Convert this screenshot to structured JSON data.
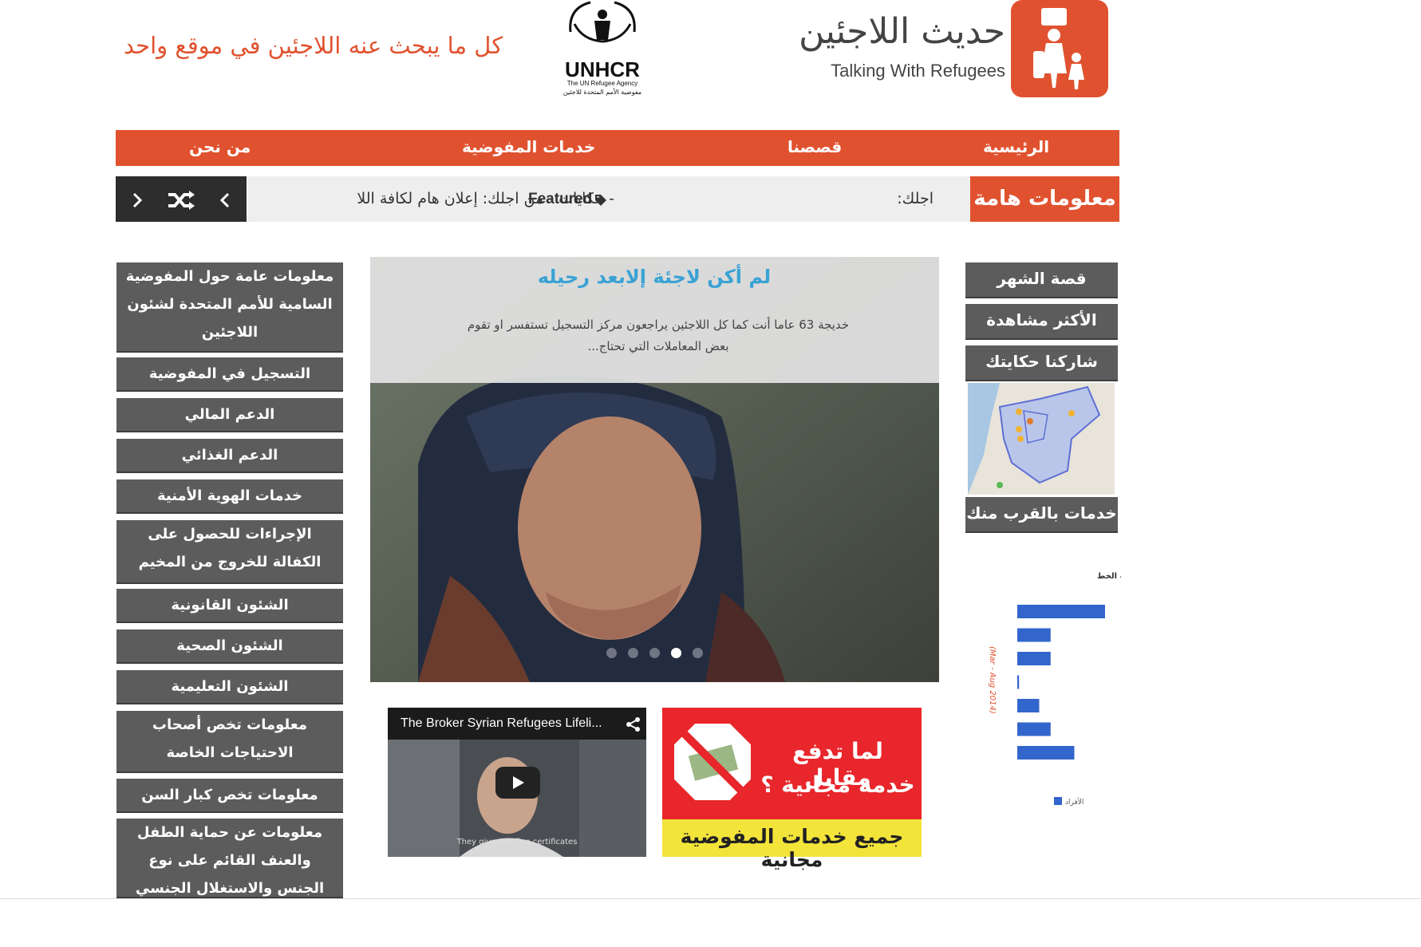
{
  "header": {
    "logo_ar": "حديث اللاجئين",
    "logo_en": "Talking With Refugees",
    "unhcr_name": "UNHCR",
    "unhcr_sub_en": "The UN Refugee Agency",
    "unhcr_sub_ar": "مفوضية الأمم المتحدة للاجئين",
    "tagline": "كل ما يبحث عنه اللاجئين في موقع واحد",
    "brand_color": "#e0522f"
  },
  "nav": {
    "items": [
      "الرئيسية",
      "قصصنا",
      "خدمات المفوضية",
      "من نحن"
    ]
  },
  "ticker": {
    "label": "معلومات هامة",
    "prefix": "اجلك:",
    "category": "Featured",
    "text": "- حكايات - من اجلك: إعلان هام لكافة اللا",
    "tag_icon": "tag-icon",
    "controls": [
      "chevron-right-icon",
      "shuffle-icon",
      "chevron-left-icon"
    ]
  },
  "left_menu": [
    "معلومات عامة حول المفوضية السامية للأمم المتحدة لشئون اللاجئين",
    "التسجيل في المفوضية",
    "الدعم المالي",
    "الدعم الغذائي",
    "خدمات الهوية الأمنية",
    "الإجراءات للحصول على الكفالة للخروج من المخيم",
    "الشئون القانونية",
    "الشئون الصحية",
    "الشئون التعليمية",
    "معلومات تخص أصحاب الاحتياجات الخاصة",
    "معلومات تخص كبار السن",
    "معلومات عن حماية الطفل والعنف القائم على نوع الجنس والاستغلال الجنسي"
  ],
  "right_menu": {
    "items": [
      "قصة الشهر",
      "الأكثر مشاهدة",
      "شاركنا حكايتك"
    ],
    "map_button": "خدمات بالقرب منك"
  },
  "slider": {
    "title": "لم أكن لاجئة إلابعد رحيله",
    "description": "خديجة 63 عاما أنت كما كل اللاجئين يراجعون مركز التسجيل تستفسر او تقوم بعض المعاملات التي تحتاج...",
    "dots": 5,
    "active_dot": 4
  },
  "video": {
    "title": "The Broker Syrian Refugees Lifeli...",
    "subtitle": "They give you five certificates",
    "share_icon": "share-icon",
    "play_icon": "play-icon"
  },
  "banner": {
    "line1": "لما تدفع مقابل",
    "line2": "خدمة مجانية ؟",
    "footer": "جميع خدمات المفوضية مجانية"
  },
  "chart_data": {
    "type": "bar",
    "orientation": "horizontal",
    "title": "معلومات الاحصائيات الخط",
    "ylabel": "(Mar - Aug 2014)",
    "legend": "الأفراد",
    "series": [
      {
        "name": "الأفراد",
        "values": [
          100,
          38,
          38,
          2,
          25,
          38,
          65
        ]
      }
    ],
    "bar_color": "#3366cc"
  }
}
